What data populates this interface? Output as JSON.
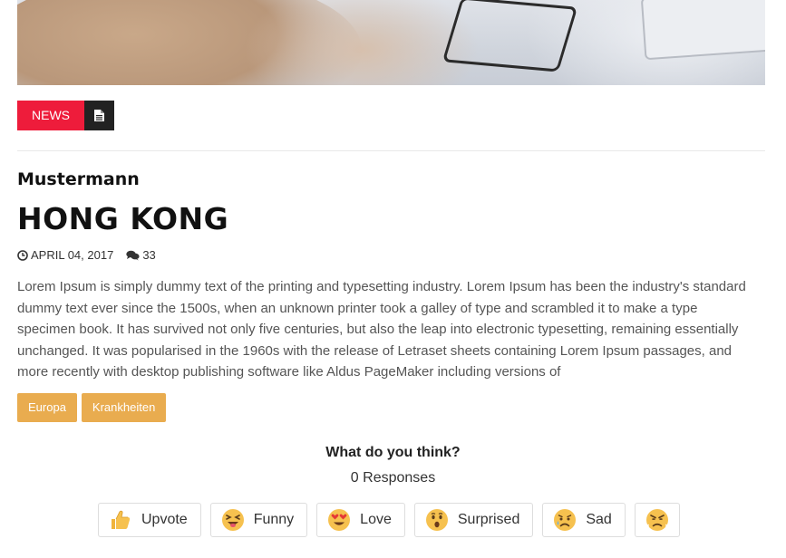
{
  "post": {
    "category": "NEWS",
    "author": "Mustermann",
    "title": "HONG KONG",
    "date": "APRIL 04, 2017",
    "comments": "33",
    "excerpt": "Lorem Ipsum is simply dummy text of the printing and typesetting industry. Lorem Ipsum has been the industry's standard dummy text ever since the 1500s, when an unknown printer took a galley of type and scrambled it to make a type specimen book. It has survived not only five centuries, but also the leap into electronic typesetting, remaining essentially unchanged. It was popularised in the 1960s with the release of Letraset sheets containing Lorem Ipsum passages, and more recently with desktop publishing software like Aldus PageMaker including versions of",
    "tags": [
      "Europa",
      "Krankheiten"
    ]
  },
  "reactions": {
    "question": "What do you think?",
    "responses": "0 Responses",
    "items": [
      {
        "label": "Upvote",
        "icon": "thumbs-up-icon"
      },
      {
        "label": "Funny",
        "icon": "laughing-emoji-icon"
      },
      {
        "label": "Love",
        "icon": "heart-eyes-emoji-icon"
      },
      {
        "label": "Surprised",
        "icon": "surprised-emoji-icon"
      },
      {
        "label": "Sad",
        "icon": "sad-emoji-icon"
      },
      {
        "label": "",
        "icon": "angry-emoji-icon"
      }
    ]
  },
  "colors": {
    "news_badge": "#ee1c3b",
    "tag": "#e9ac4f",
    "doc_badge": "#222222"
  }
}
